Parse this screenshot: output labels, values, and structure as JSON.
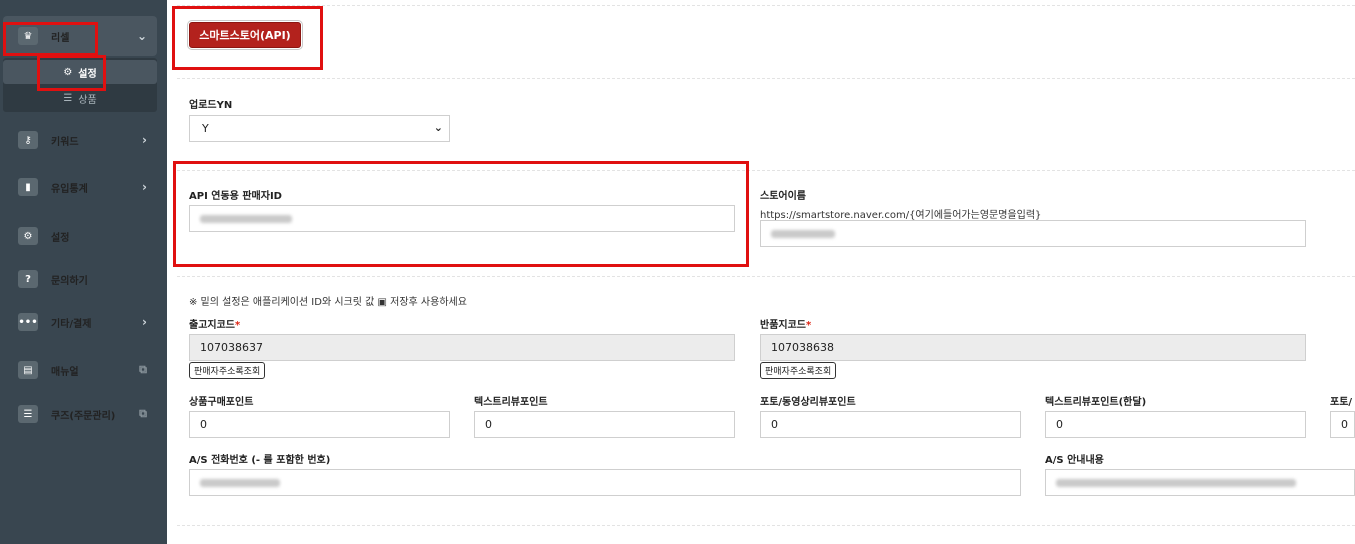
{
  "sidebar": {
    "reseller": {
      "label": "리셀",
      "icon": "crown-icon"
    },
    "sub": [
      {
        "label": "설정",
        "icon": "gear-icon"
      },
      {
        "label": "상품",
        "icon": "list-icon"
      }
    ],
    "items": [
      {
        "label": "키워드",
        "icon": "key-icon"
      },
      {
        "label": "유입통계",
        "icon": "bar-chart-icon"
      },
      {
        "label": "설정",
        "icon": "gear-icon"
      },
      {
        "label": "문의하기",
        "icon": "question-icon"
      },
      {
        "label": "기타/결제",
        "icon": "more-icon"
      },
      {
        "label": "매뉴얼",
        "icon": "book-icon"
      },
      {
        "label": "쿠즈(주문관리)",
        "icon": "checklist-icon"
      }
    ]
  },
  "main": {
    "smartstore_button": "스마트스토어(API)",
    "upload": {
      "label": "업로드YN",
      "value": "Y"
    },
    "api_seller_id": {
      "label": "API 연동용 판매자ID"
    },
    "store_name": {
      "label": "스토어이름",
      "hint": "https://smartstore.naver.com/{여기에들어가는영문명을입력}"
    },
    "notice": {
      "before": "※ 밑의 설정은 애플리케이션 ID와 시크릿 값",
      "icon": "save-icon",
      "after": "저장후 사용하세요"
    },
    "shipping_code": {
      "label": "출고지코드",
      "required": "*",
      "value": "107038637",
      "lookup": "판매자주소록조회"
    },
    "return_code": {
      "label": "반품지코드",
      "required": "*",
      "value": "107038638",
      "lookup": "판매자주소록조회"
    },
    "points": [
      {
        "label": "상품구매포인트",
        "value": "0"
      },
      {
        "label": "텍스트리뷰포인트",
        "value": "0"
      },
      {
        "label": "포토/동영상리뷰포인트",
        "value": "0"
      },
      {
        "label": "텍스트리뷰포인트(한달)",
        "value": "0"
      },
      {
        "label": "포토/",
        "value": "0"
      }
    ],
    "as_phone": {
      "label": "A/S 전화번호 (- 를 포함한 번호)"
    },
    "as_info": {
      "label": "A/S 안내내용"
    }
  },
  "colors": {
    "sidebar": "#394650",
    "accent": "#b3221d",
    "highlight": "#e01010"
  }
}
